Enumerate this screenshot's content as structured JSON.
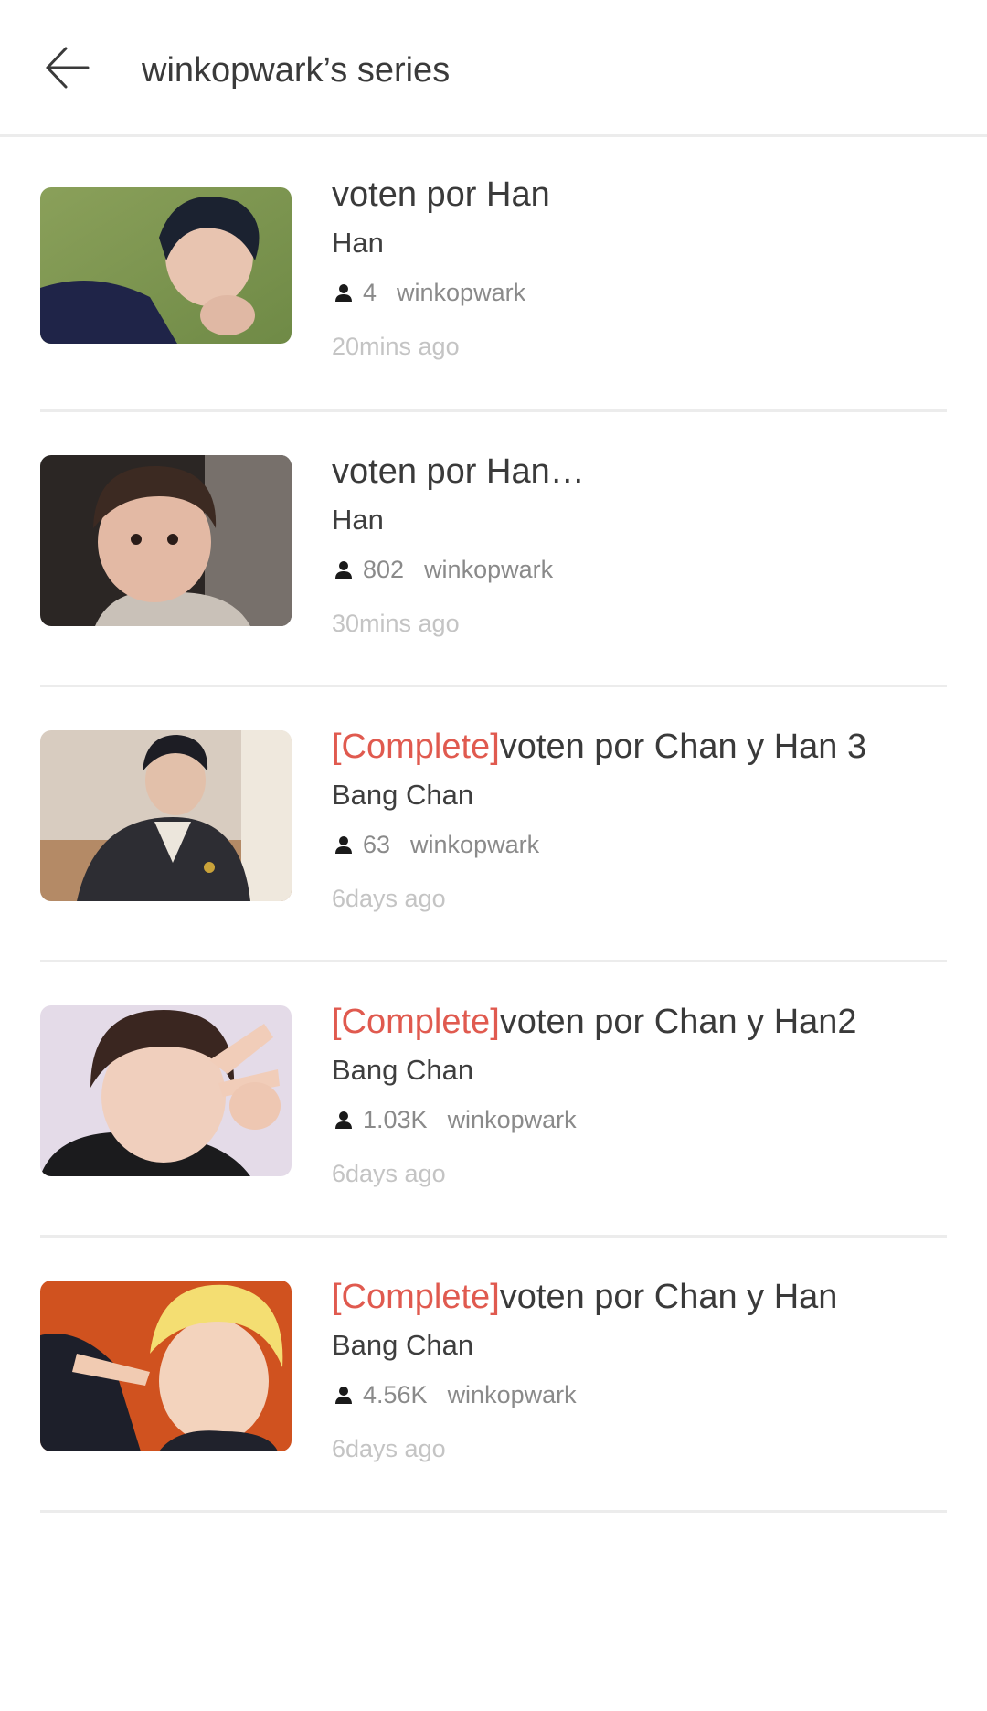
{
  "header": {
    "title": "winkopwark’s series"
  },
  "items": [
    {
      "tag": "",
      "title": "voten por Han",
      "author": "Han",
      "reads": "4",
      "username": "winkopwark",
      "time": "20mins ago"
    },
    {
      "tag": "",
      "title": "voten por Han…",
      "author": "Han",
      "reads": "802",
      "username": "winkopwark",
      "time": "30mins ago"
    },
    {
      "tag": "[Complete]",
      "title": "voten por Chan y Han 3",
      "author": "Bang Chan",
      "reads": "63",
      "username": "winkopwark",
      "time": "6days ago"
    },
    {
      "tag": "[Complete]",
      "title": "voten por Chan y Han2",
      "author": "Bang Chan",
      "reads": "1.03K",
      "username": "winkopwark",
      "time": "6days ago"
    },
    {
      "tag": "[Complete]",
      "title": "voten por Chan y Han",
      "author": "Bang Chan",
      "reads": "4.56K",
      "username": "winkopwark",
      "time": "6days ago"
    }
  ],
  "colors": {
    "accent_tag": "#e05a4f",
    "divider": "#ececec",
    "muted_text": "#8a8a8a",
    "faint_text": "#c4c4c4"
  },
  "icons": {
    "back": "arrow-left-icon",
    "reads": "person-icon"
  }
}
